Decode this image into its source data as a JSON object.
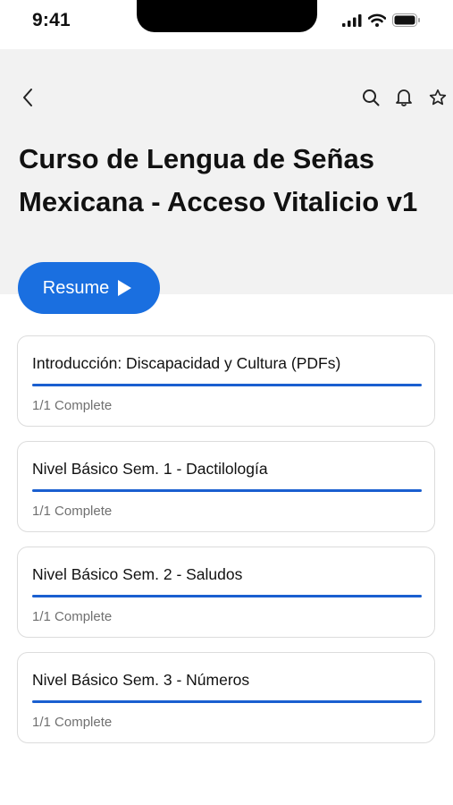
{
  "status_bar": {
    "time": "9:41"
  },
  "nav": {
    "back_icon": "chevron-left-icon",
    "search_icon": "search-icon",
    "bell_icon": "bell-icon",
    "star_icon": "star-icon"
  },
  "course": {
    "title": "Curso de Lengua de Señas Mexicana - Acceso Vitalicio v1"
  },
  "resume_button": {
    "label": "Resume",
    "icon": "play-icon"
  },
  "sections": [
    {
      "title": "Introducción: Discapacidad y Cultura (PDFs)",
      "status": "1/1 Complete",
      "progress": 1.0
    },
    {
      "title": "Nivel Básico Sem. 1 - Dactilología",
      "status": "1/1 Complete",
      "progress": 1.0
    },
    {
      "title": "Nivel Básico Sem. 2 - Saludos",
      "status": "1/1 Complete",
      "progress": 1.0
    },
    {
      "title": "Nivel Básico Sem. 3 - Números",
      "status": "1/1 Complete",
      "progress": 1.0
    }
  ],
  "colors": {
    "accent": "#1a6fe0",
    "progress": "#1a5fd0",
    "hero_bg": "#f2f2f2",
    "muted_text": "#707070"
  }
}
